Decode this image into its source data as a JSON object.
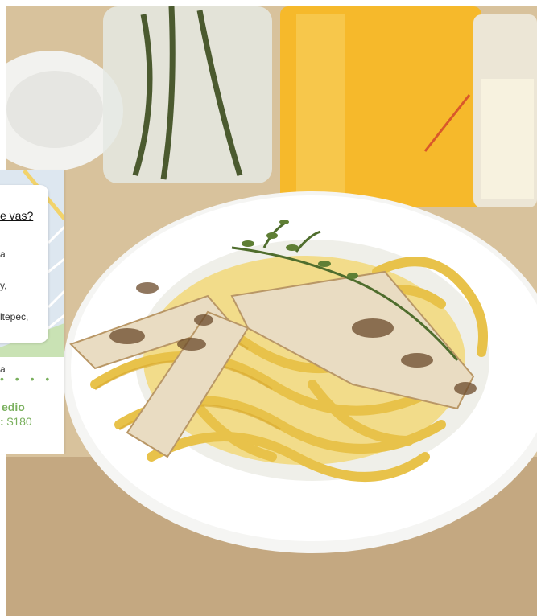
{
  "location_card": {
    "question": "e vas?",
    "address_lines": [
      "a",
      "y,",
      "ltepec,",
      "",
      "a"
    ]
  },
  "plan": {
    "dots": "• • • •",
    "name": "edio",
    "price_prefix": ":",
    "price": "$180"
  },
  "colors": {
    "accent_green": "#7ab05e",
    "map_blue": "#dde7f0",
    "map_green": "#c9e2b4",
    "sauce_yellow": "#e8c24a"
  },
  "icons": [
    "map-background"
  ]
}
